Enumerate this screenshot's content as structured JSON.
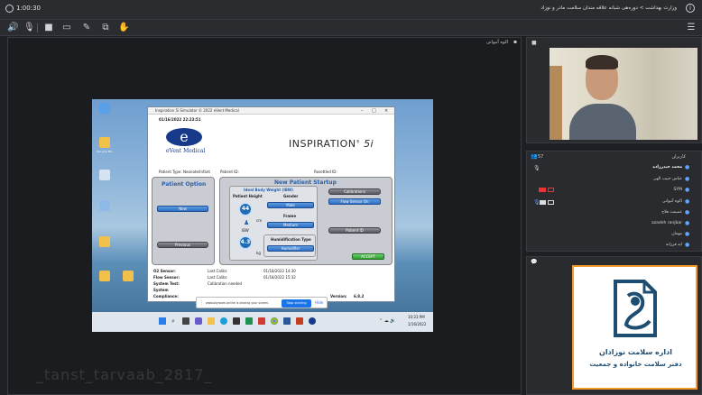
{
  "topbar": {
    "title": "وزارت بهداشت > دوره‌هی شبانه علاقه مندان سلامت مادر و نوزاد",
    "timer": "1:00:30"
  },
  "presentation": {
    "panel_title": "اکوه آنیوانی",
    "desktop_icons": [
      "Recycle Bin",
      "",
      "",
      "",
      "",
      ""
    ],
    "app": {
      "title": "Inspiration 5i Simulator © 2022 eVent Medical",
      "datetime": "01/16/2022 22:23:51",
      "brand": "eVent Medical",
      "product": "INSPIRATION",
      "product_suffix": "5i",
      "patient_type": "Patient Type: Neonate/Infant",
      "patient_id": "Patient ID:",
      "resettled_id": "Resettled ID:",
      "patient_option_title": "Patient Option",
      "new_btn": "New",
      "previous_btn": "Previous",
      "new_startup_title": "New Patient Startup",
      "ibw_title": "Ideal Body Weight (IBW)",
      "patient_height": "Patient Height",
      "height_value": "44",
      "height_unit": "cm",
      "ibw_label": "IBW",
      "weight_value": "4.3",
      "weight_unit": "kg",
      "gender_label": "Gender",
      "gender_value": "Male",
      "frame_label": "Frame",
      "frame_value": "Medium",
      "humid_label": "Humidification Type",
      "humid_value": "Humidifier",
      "calibrations_btn": "Calibrations",
      "flow_sensor_btn": "Flow Sensor On",
      "patient_id_btn": "Patient ID",
      "accept_btn": "ACCEPT",
      "o2_sensor": "O2 Sensor:",
      "o2_last": "Last Calibr.",
      "o2_date": "01/18/2022 14:30",
      "flow_sensor": "Flow Sensor:",
      "flow_last": "Last Calibr.",
      "flow_date": "01/18/2022 15:32",
      "system_test": "System Test:",
      "system_test_status": "Calibration needed",
      "system": "System",
      "compliance": "Compliance:",
      "version_label": "Version:",
      "version_value": "6.8.2"
    },
    "share_bar": {
      "text": "www.skyroom.online is sharing your screen.",
      "stop": "Stop sharing",
      "hide": "Hide"
    },
    "taskbar_time": "10:23 PM",
    "taskbar_date": "1/16/2022",
    "watermark": "_tanst_tarvaab_2817_"
  },
  "camera": {
    "title": ""
  },
  "attendees": {
    "title": "کاربران",
    "count": "57",
    "list": [
      "محمد حیدرزاده",
      "عباس حبیب الهی",
      "SYM",
      "اکوه آنیوانی",
      "عصمت فلاح",
      "azadeh ranjbar",
      "مهمان",
      "ایه فرزانه"
    ]
  },
  "chat": {
    "logo_line1": "اداره سلامت نوزادان",
    "logo_line2": "دفتر سلامت خانواده و جمعیت"
  }
}
